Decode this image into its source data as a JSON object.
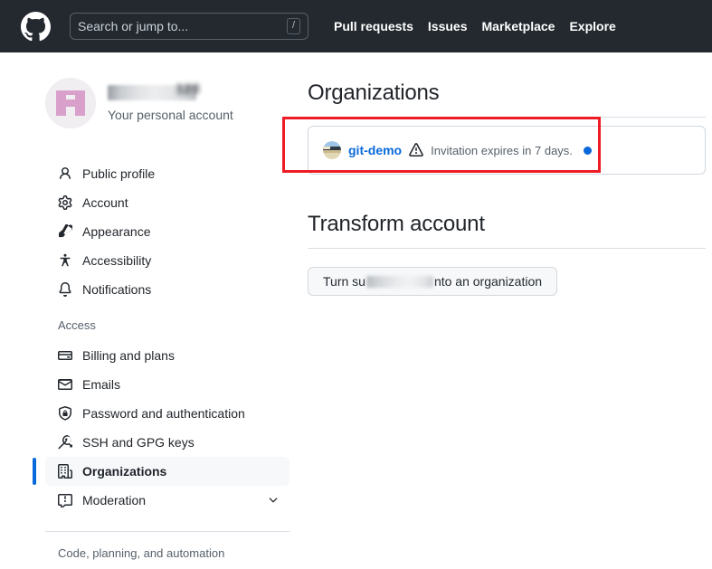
{
  "header": {
    "logo_icon": "github-mark-icon",
    "search": {
      "placeholder": "Search or jump to...",
      "value": "",
      "shortcut_badge": "/"
    },
    "nav": [
      {
        "label": "Pull requests"
      },
      {
        "label": "Issues"
      },
      {
        "label": "Marketplace"
      },
      {
        "label": "Explore"
      }
    ],
    "background_color": "#24292f"
  },
  "sidebar": {
    "account": {
      "username": "",
      "username_redacted": true,
      "username_visible_fragment": "123",
      "subtitle": "Your personal account",
      "avatar_icon": "identicon-avatar",
      "avatar_color": "#d9a0cc"
    },
    "items": [
      {
        "label": "Public profile",
        "icon": "person-icon",
        "selected": false
      },
      {
        "label": "Account",
        "icon": "gear-icon",
        "selected": false
      },
      {
        "label": "Appearance",
        "icon": "paintbrush-icon",
        "selected": false
      },
      {
        "label": "Accessibility",
        "icon": "accessibility-icon",
        "selected": false
      },
      {
        "label": "Notifications",
        "icon": "bell-icon",
        "selected": false
      }
    ],
    "access_section": {
      "title": "Access",
      "items": [
        {
          "label": "Billing and plans",
          "icon": "credit-card-icon",
          "selected": false,
          "expandable": false
        },
        {
          "label": "Emails",
          "icon": "mail-icon",
          "selected": false,
          "expandable": false
        },
        {
          "label": "Password and authentication",
          "icon": "shield-lock-icon",
          "selected": false,
          "expandable": false
        },
        {
          "label": "SSH and GPG keys",
          "icon": "key-icon",
          "selected": false,
          "expandable": false
        },
        {
          "label": "Organizations",
          "icon": "organization-icon",
          "selected": true,
          "expandable": false
        },
        {
          "label": "Moderation",
          "icon": "report-icon",
          "selected": false,
          "expandable": true
        }
      ]
    },
    "bottom_section": {
      "title": "Code, planning, and automation"
    }
  },
  "main": {
    "organizations": {
      "heading": "Organizations",
      "rows": [
        {
          "avatar_icon": "org-avatar-photo",
          "name": "git-demo",
          "warning_icon": "alert-triangle-icon",
          "status": "Invitation expires in 7 days.",
          "unread_dot": true,
          "dot_color": "#0969da",
          "annotated": true,
          "annotation_color": "#ee1c25"
        }
      ]
    },
    "transform_account": {
      "heading": "Transform account",
      "button": {
        "prefix": "Turn su",
        "redacted": true,
        "suffix": "nto an organization"
      }
    }
  }
}
